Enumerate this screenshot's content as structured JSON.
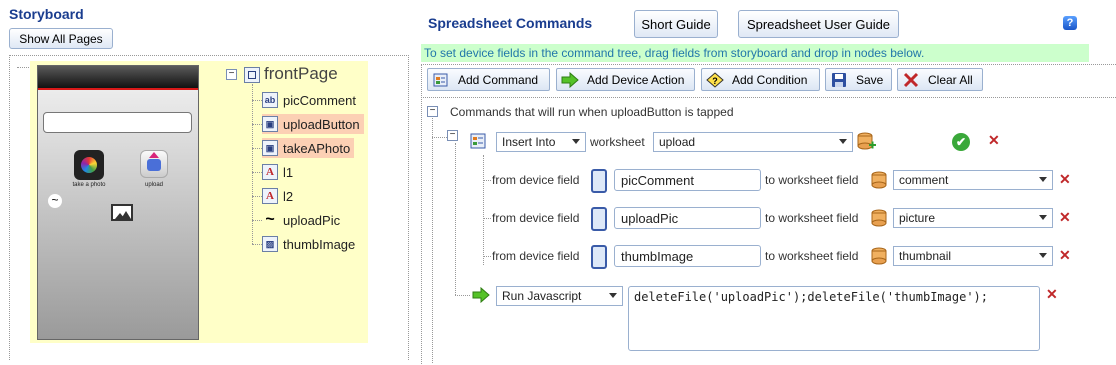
{
  "storyboard": {
    "title": "Storyboard",
    "show_all_pages": "Show All Pages",
    "phone": {
      "take_photo_label": "take a photo",
      "upload_label": "upload"
    },
    "tree": {
      "root": "frontPage",
      "items": [
        {
          "label": "picComment",
          "icon": "ab",
          "highlight": false
        },
        {
          "label": "uploadButton",
          "icon": "btn",
          "highlight": true
        },
        {
          "label": "takeAPhoto",
          "icon": "btn",
          "highlight": true
        },
        {
          "label": "l1",
          "icon": "A",
          "highlight": false
        },
        {
          "label": "l2",
          "icon": "A",
          "highlight": false
        },
        {
          "label": "uploadPic",
          "icon": "~",
          "highlight": false
        },
        {
          "label": "thumbImage",
          "icon": "img",
          "highlight": false
        }
      ]
    }
  },
  "commands": {
    "title": "Spreadsheet Commands",
    "short_guide": "Short Guide",
    "user_guide": "Spreadsheet User Guide",
    "help": "?",
    "hint": "To set device fields in the command tree, drag fields from storyboard and drop in nodes below.",
    "toolbar": {
      "add_command": "Add Command",
      "add_device_action": "Add Device Action",
      "add_condition": "Add Condition",
      "save": "Save",
      "clear_all": "Clear All"
    },
    "root_label": "Commands that will run when uploadButton is tapped",
    "insert": {
      "action": "Insert Into",
      "worksheet_label": "worksheet",
      "worksheet": "upload"
    },
    "mappings": [
      {
        "from_label": "from device field",
        "field": "picComment",
        "to_label": "to worksheet field",
        "column": "comment"
      },
      {
        "from_label": "from device field",
        "field": "uploadPic",
        "to_label": "to worksheet field",
        "column": "picture"
      },
      {
        "from_label": "from device field",
        "field": "thumbImage",
        "to_label": "to worksheet field",
        "column": "thumbnail"
      }
    ],
    "javascript": {
      "action": "Run Javascript",
      "code": "deleteFile('uploadPic');deleteFile('thumbImage');"
    }
  }
}
